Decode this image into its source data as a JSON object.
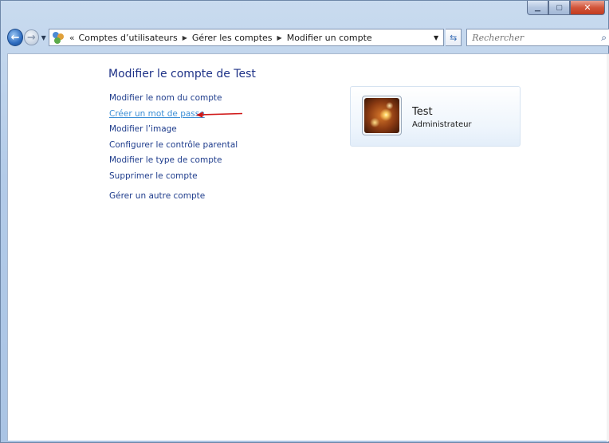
{
  "window": {
    "controls": {
      "minimize_icon": "minimize-icon",
      "maximize_icon": "maximize-icon",
      "close_icon": "close-icon",
      "close_color": "#c9452a"
    }
  },
  "navbar": {
    "breadcrumb_overflow": "«",
    "breadcrumb": [
      "Comptes d’utilisateurs",
      "Gérer les comptes",
      "Modifier un compte"
    ],
    "search_placeholder": "Rechercher"
  },
  "main": {
    "title": "Modifier le compte de Test",
    "tasks": [
      "Modifier le nom du compte",
      "Créer un mot de passe",
      "Modifier l’image",
      "Configurer le contrôle parental",
      "Modifier le type de compte",
      "Supprimer le compte"
    ],
    "other_task": "Gérer un autre compte",
    "highlighted_task_index": 1,
    "annotation_arrow_color": "#d01818"
  },
  "account": {
    "name": "Test",
    "role": "Administrateur"
  },
  "colors": {
    "link": "#1e3c8c",
    "link_hover": "#3c8fd6",
    "title": "#1e3287"
  }
}
